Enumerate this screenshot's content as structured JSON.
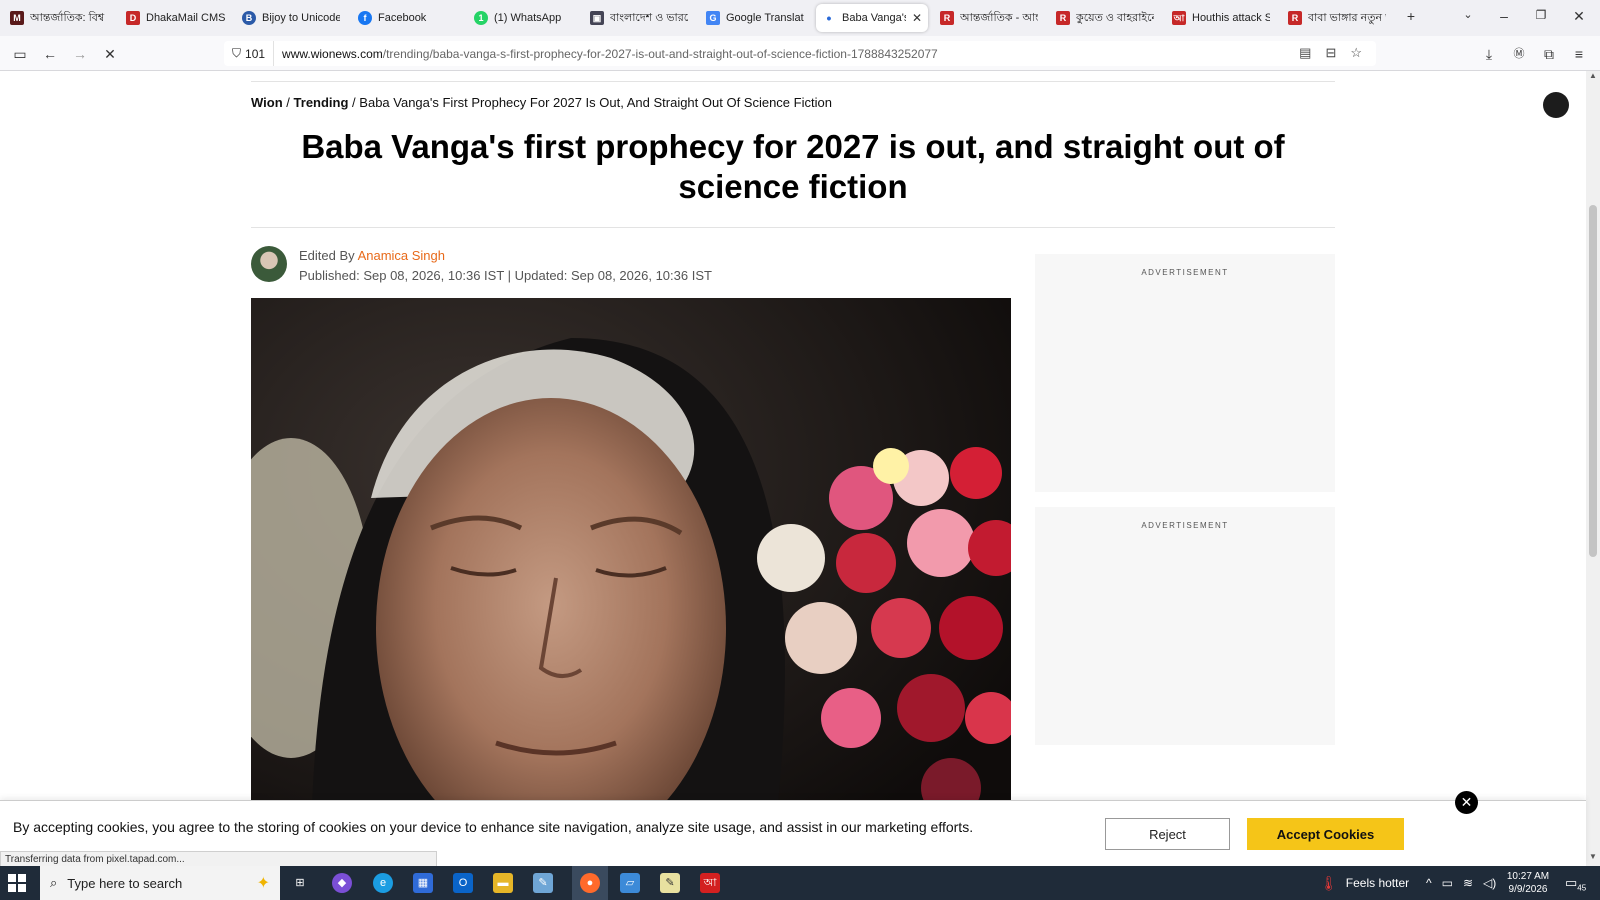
{
  "browser": {
    "tabs": [
      {
        "label": "আন্তর্জাতিক: বিশ্ব রা",
        "icon": "tab-icon-m",
        "color": "#7a1f1f"
      },
      {
        "label": "DhakaMail CMS",
        "icon": "tab-icon-d",
        "color": "#c62828"
      },
      {
        "label": "Bijoy to Unicode w",
        "icon": "tab-icon-bijoy",
        "color": "#2b5aa8"
      },
      {
        "label": "Facebook",
        "icon": "facebook-icon",
        "color": "#1877f2"
      },
      {
        "label": "(1) WhatsApp",
        "icon": "whatsapp-icon",
        "color": "#25d366"
      },
      {
        "label": "বাংলাদেশ ও ভারতে",
        "icon": "tab-icon-news",
        "color": "#445"
      },
      {
        "label": "Google Translate",
        "icon": "google-translate-icon",
        "color": "#4285f4"
      },
      {
        "label": "Baba Vanga's fi",
        "icon": "loading-dot-icon",
        "color": "#2a6ad8",
        "active": true
      },
      {
        "label": "আন্তর্জাতিক - আন্ত",
        "icon": "tab-icon-red",
        "color": "#c62828"
      },
      {
        "label": "কুয়েত ও বাহরাইনে",
        "icon": "tab-icon-red",
        "color": "#c62828"
      },
      {
        "label": "Houthis attack Sau",
        "icon": "tab-icon-red",
        "color": "#c62828"
      },
      {
        "label": "বাবা ভাঙ্গার নতুন ভ",
        "icon": "tab-icon-red",
        "color": "#c62828"
      }
    ],
    "security_count": "101",
    "url_domain": "www.wionews.com",
    "url_path": "/trending/baba-vanga-s-first-prophecy-for-2027-is-out-and-straight-out-of-science-fiction-1788843252077",
    "status_text": "Transferring data from pixel.tapad.com..."
  },
  "article": {
    "breadcrumb": {
      "site": "Wion",
      "sep1": "/",
      "section": "Trending",
      "sep2": "/",
      "current": "Baba Vanga's First Prophecy For 2027 Is Out, And Straight Out Of Science Fiction"
    },
    "headline": "Baba Vanga's first prophecy for 2027 is out, and straight out of science fiction",
    "edited_by_label": "Edited By",
    "editor_name": "Anamica Singh",
    "published_line": "Published: Sep 08, 2026, 10:36 IST | Updated: Sep 08, 2026, 10:36 IST"
  },
  "ads": [
    {
      "label": "ADVERTISEMENT"
    },
    {
      "label": "ADVERTISEMENT"
    }
  ],
  "cookie_banner": {
    "text": "By accepting cookies, you agree to the storing of cookies on your device to enhance site navigation, analyze site usage, and assist in our marketing efforts.",
    "reject_label": "Reject",
    "accept_label": "Accept Cookies",
    "accept_color": "#f5c518"
  },
  "taskbar": {
    "search_placeholder": "Type here to search",
    "weather": "Feels hotter",
    "time": "10:27 AM",
    "date": "9/9/2026",
    "notification_count": "45"
  }
}
